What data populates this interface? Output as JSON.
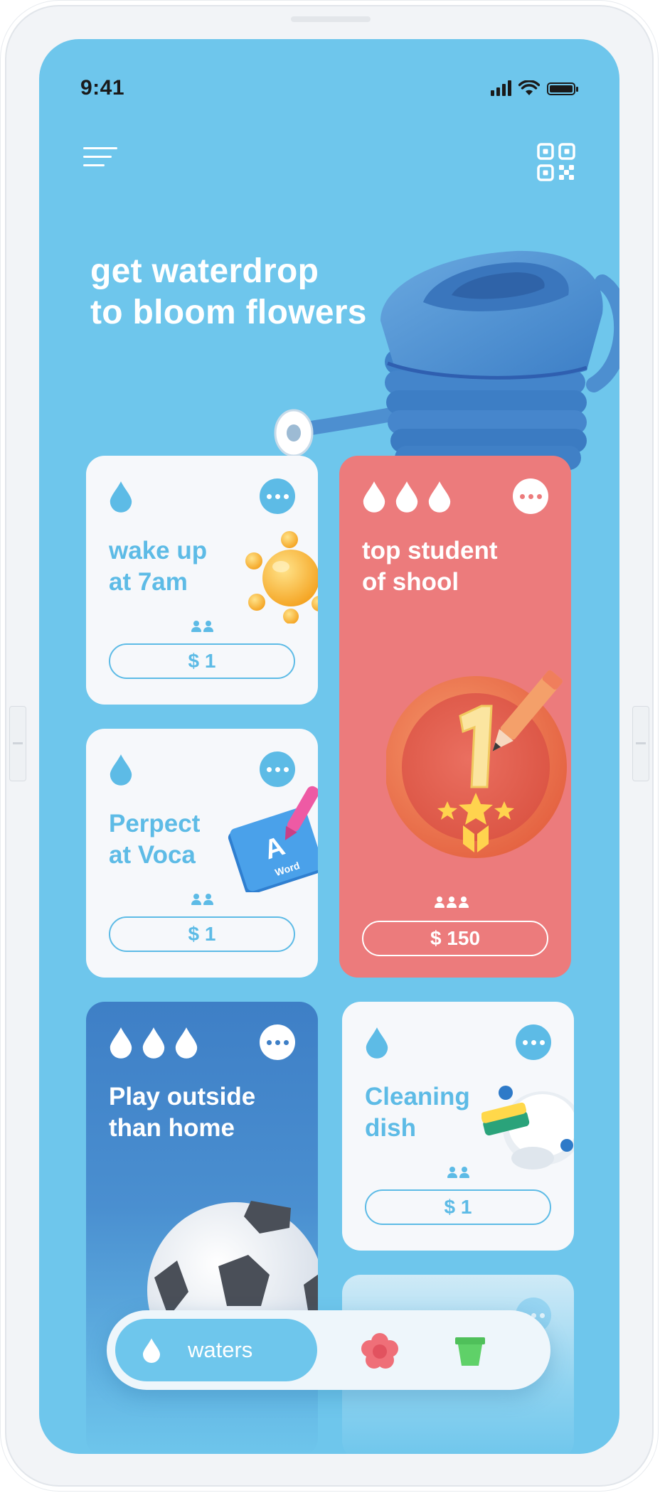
{
  "status_bar": {
    "time": "9:41"
  },
  "hero": {
    "line1": "get waterdrop",
    "line2": "to bloom flowers"
  },
  "cards": [
    {
      "title_line1": "wake up",
      "title_line2": "at 7am",
      "price": "$ 1",
      "drops": 1,
      "members": 2,
      "color": "#f6f8fb",
      "illustration": "sun"
    },
    {
      "title_line1": "top student",
      "title_line2": "of shool",
      "price": "$ 150",
      "drops": 3,
      "members": 3,
      "color": "#ec7b7c",
      "illustration": "gold-medal"
    },
    {
      "title_line1": "Perpect",
      "title_line2": "at Voca",
      "price": "$ 1",
      "drops": 1,
      "members": 2,
      "color": "#f6f8fb",
      "illustration": "word-book",
      "book_letter": "A",
      "book_label": "Word"
    },
    {
      "title_line1": "Play outside",
      "title_line2": "than home",
      "drops": 3,
      "color": "#3e7fc6",
      "illustration": "soccer-ball"
    },
    {
      "title_line1": "Cleaning",
      "title_line2": "dish",
      "price": "$ 1",
      "drops": 1,
      "members": 2,
      "color": "#f6f8fb",
      "illustration": "dish-sponge"
    }
  ],
  "bottom_nav": {
    "active_label": "waters",
    "tabs": [
      "waters-tab",
      "flower-tab",
      "pot-tab"
    ]
  },
  "colors": {
    "screen": "#6ec6ec",
    "accent": "#5dbbe6",
    "red_card": "#ec7b7c",
    "blue_card": "#3e7fc6"
  }
}
